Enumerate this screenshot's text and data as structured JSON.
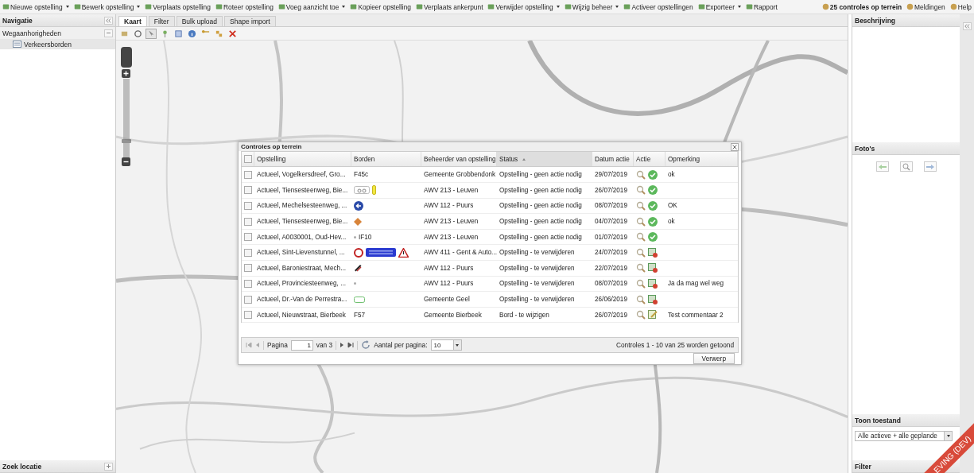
{
  "toolbar": {
    "items": [
      {
        "label": "Nieuwe opstelling",
        "dropdown": true
      },
      {
        "label": "Bewerk opstelling",
        "dropdown": true
      },
      {
        "label": "Verplaats opstelling",
        "dropdown": false
      },
      {
        "label": "Roteer opstelling",
        "dropdown": false
      },
      {
        "label": "Voeg aanzicht toe",
        "dropdown": true
      },
      {
        "label": "Kopieer opstelling",
        "dropdown": false
      },
      {
        "label": "Verplaats ankerpunt",
        "dropdown": false
      },
      {
        "label": "Verwijder opstelling",
        "dropdown": true
      },
      {
        "label": "Wijzig beheer",
        "dropdown": true
      },
      {
        "label": "Activeer opstellingen",
        "dropdown": false
      },
      {
        "label": "Exporteer",
        "dropdown": true
      },
      {
        "label": "Rapport",
        "dropdown": false
      }
    ],
    "right": [
      {
        "label": "25 controles op terrein",
        "bold": true
      },
      {
        "label": "Meldingen",
        "bold": false
      },
      {
        "label": "Help",
        "bold": false
      }
    ]
  },
  "navigation": {
    "title": "Navigatie",
    "group": {
      "label": "Wegaanhorigheden",
      "expanded": true,
      "children": [
        {
          "label": "Verkeersborden",
          "selected": true
        }
      ]
    },
    "search": "Zoek locatie"
  },
  "tabs": [
    {
      "label": "Kaart",
      "selected": true
    },
    {
      "label": "Filter",
      "selected": false
    },
    {
      "label": "Bulk upload",
      "selected": false
    },
    {
      "label": "Shape import",
      "selected": false
    }
  ],
  "map_tools": [
    {
      "kind": "layers",
      "selected": false
    },
    {
      "kind": "zoom-box",
      "selected": false
    },
    {
      "kind": "pointer",
      "selected": true
    },
    {
      "kind": "pin",
      "selected": false
    },
    {
      "kind": "square",
      "selected": false
    },
    {
      "kind": "info",
      "selected": false
    },
    {
      "kind": "key",
      "selected": false
    },
    {
      "kind": "move",
      "selected": false
    },
    {
      "kind": "delete",
      "selected": false
    }
  ],
  "map_zoom": {
    "level": 0.2
  },
  "dialog": {
    "title": "Controles op terrein",
    "columns": [
      {
        "label": "Opstelling",
        "sorted": false
      },
      {
        "label": "Borden",
        "sorted": false
      },
      {
        "label": "Beheerder van opstelling",
        "sorted": false
      },
      {
        "label": "Status",
        "sorted": true
      },
      {
        "label": "Datum actie",
        "sorted": false
      },
      {
        "label": "Actie",
        "sorted": false
      },
      {
        "label": "Opmerking",
        "sorted": false
      }
    ],
    "all_checked": false,
    "rows": [
      {
        "checked": false,
        "opstelling": "Actueel, Vogelkersdreef, Gro...",
        "borden": [
          {
            "kind": "text",
            "text": "F45c"
          }
        ],
        "beheerder": "Gemeente Grobbendonk",
        "status": "Opstelling - geen actie nodig",
        "datum": "29/07/2019",
        "action": {
          "kind": "ok"
        },
        "opmerking": "ok"
      },
      {
        "checked": false,
        "opstelling": "Actueel, Tiensesteenweg, Bie...",
        "borden": [
          {
            "kind": "bicycle"
          },
          {
            "kind": "post"
          }
        ],
        "beheerder": "AWV 213 - Leuven",
        "status": "Opstelling - geen actie nodig",
        "datum": "26/07/2019",
        "action": {
          "kind": "ok"
        }
      },
      {
        "checked": false,
        "opstelling": "Actueel, Mechelsesteenweg, ...",
        "borden": [
          {
            "kind": "arrow"
          }
        ],
        "beheerder": "AWV 112 - Puurs",
        "status": "Opstelling - geen actie nodig",
        "datum": "08/07/2019",
        "action": {
          "kind": "ok"
        },
        "opmerking": "OK"
      },
      {
        "checked": false,
        "opstelling": "Actueel, Tiensesteenweg, Bie...",
        "borden": [
          {
            "kind": "diamond"
          }
        ],
        "beheerder": "AWV 213 - Leuven",
        "status": "Opstelling - geen actie nodig",
        "datum": "04/07/2019",
        "action": {
          "kind": "ok"
        },
        "opmerking": "ok"
      },
      {
        "checked": false,
        "opstelling": "Actueel, A0030001, Oud-Hev...",
        "borden": [
          {
            "kind": "dot"
          },
          {
            "kind": "text",
            "text": "IF10"
          }
        ],
        "beheerder": "AWV 213 - Leuven",
        "status": "Opstelling - geen actie nodig",
        "datum": "01/07/2019",
        "action": {
          "kind": "ok"
        }
      },
      {
        "checked": false,
        "opstelling": "Actueel, Sint-Lievenstunnel, ...",
        "borden": [
          {
            "kind": "ring"
          },
          {
            "kind": "plate"
          },
          {
            "kind": "warning"
          }
        ],
        "beheerder": "AWV 411 - Gent & Auto...",
        "status": "Opstelling - te verwijderen",
        "datum": "24/07/2019",
        "action": {
          "kind": "remove"
        }
      },
      {
        "checked": false,
        "opstelling": "Actueel, Baroniestraat, Mech...",
        "borden": [
          {
            "kind": "stripe"
          }
        ],
        "beheerder": "AWV 112 - Puurs",
        "status": "Opstelling - te verwijderen",
        "datum": "22/07/2019",
        "action": {
          "kind": "remove"
        }
      },
      {
        "checked": false,
        "opstelling": "Actueel, Provinciesteenweg, ...",
        "borden": [
          {
            "kind": "dot"
          }
        ],
        "beheerder": "AWV 112 - Puurs",
        "status": "Opstelling - te verwijderen",
        "datum": "08/07/2019",
        "action": {
          "kind": "remove"
        },
        "opmerking": "Ja da mag wel weg"
      },
      {
        "checked": false,
        "opstelling": "Actueel, Dr.-Van de Perrestra...",
        "borden": [
          {
            "kind": "green-plate"
          }
        ],
        "beheerder": "Gemeente Geel",
        "status": "Opstelling - te verwijderen",
        "datum": "26/06/2019",
        "action": {
          "kind": "remove"
        }
      },
      {
        "checked": false,
        "opstelling": "Actueel, Nieuwstraat, Bierbeek",
        "borden": [
          {
            "kind": "text",
            "text": "F57"
          }
        ],
        "beheerder": "Gemeente Bierbeek",
        "status": "Bord - te wijzigen",
        "datum": "26/07/2019",
        "action": {
          "kind": "edit"
        },
        "opmerking": "Test commentaar 2"
      }
    ],
    "pager": {
      "first_disabled": true,
      "last_disabled": false,
      "page_label": "Pagina",
      "page": "1",
      "of": "van 3",
      "per_page_label": "Aantal per pagina:",
      "per_page": "10",
      "summary": "Controles 1 - 10 van 25 worden getoond"
    },
    "button": "Verwerp"
  },
  "right_panel": {
    "description_title": "Beschrijving",
    "photos_title": "Foto's",
    "state_title": "Toon toestand",
    "state_value": "Alle actieve + alle geplande",
    "filter_title": "Filter"
  },
  "ribbon": "EVING (DEV)"
}
